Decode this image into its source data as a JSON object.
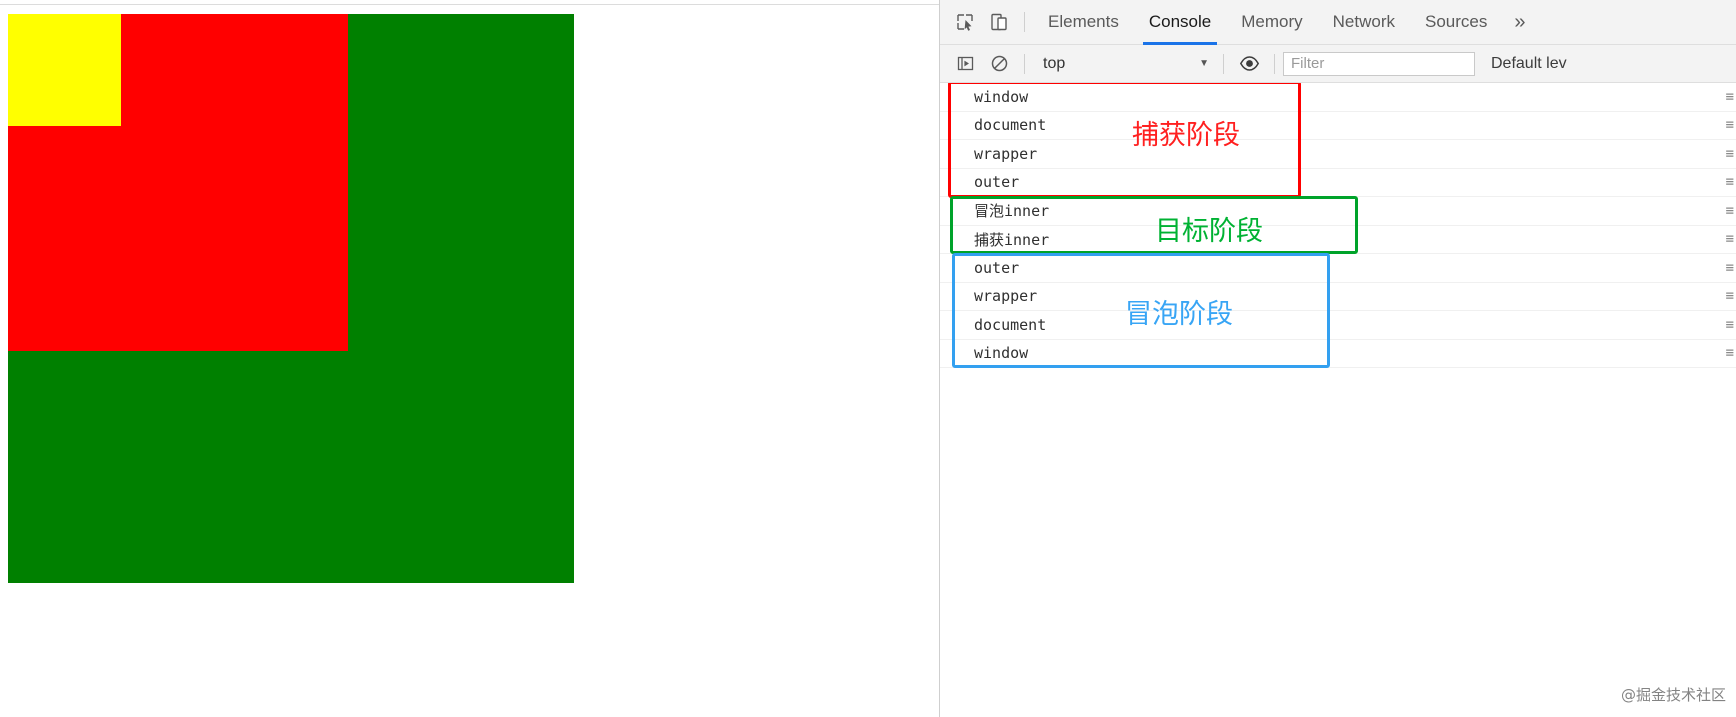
{
  "page_preview": {
    "boxes": [
      {
        "name": "outer",
        "color": "#008000"
      },
      {
        "name": "wrapper",
        "color": "#ff0000"
      },
      {
        "name": "inner",
        "color": "#ffff00"
      }
    ]
  },
  "devtools": {
    "toolbar": {
      "inspect_icon": "inspect-element-icon",
      "device_icon": "device-toolbar-icon",
      "more_tabs": "»"
    },
    "tabs": [
      {
        "id": "elements",
        "label": "Elements",
        "active": false
      },
      {
        "id": "console",
        "label": "Console",
        "active": true
      },
      {
        "id": "memory",
        "label": "Memory",
        "active": false
      },
      {
        "id": "network",
        "label": "Network",
        "active": false
      },
      {
        "id": "sources",
        "label": "Sources",
        "active": false
      }
    ],
    "filterbar": {
      "execute_icon": "execute-sidebar-icon",
      "clear_icon": "clear-console-icon",
      "context": "top",
      "context_caret": "▼",
      "eye_icon": "live-expression-eye-icon",
      "filter_value": "",
      "filter_placeholder": "Filter",
      "level_label": "Default lev"
    },
    "console_messages": [
      {
        "text": "window",
        "source": "≡"
      },
      {
        "text": "document",
        "source": "≡"
      },
      {
        "text": "wrapper",
        "source": "≡"
      },
      {
        "text": "outer",
        "source": "≡"
      },
      {
        "text": "冒泡inner",
        "source": "≡"
      },
      {
        "text": "捕获inner",
        "source": "≡"
      },
      {
        "text": "outer",
        "source": "≡"
      },
      {
        "text": "wrapper",
        "source": "≡"
      },
      {
        "text": "document",
        "source": "≡"
      },
      {
        "text": "window",
        "source": "≡"
      }
    ],
    "annotations": [
      {
        "id": "capture",
        "label": "捕获阶段",
        "color": "#ff0000"
      },
      {
        "id": "target",
        "label": "目标阶段",
        "color": "#00a32a"
      },
      {
        "id": "bubble",
        "label": "冒泡阶段",
        "color": "#33a0f0"
      }
    ]
  },
  "watermark": "@掘金技术社区"
}
